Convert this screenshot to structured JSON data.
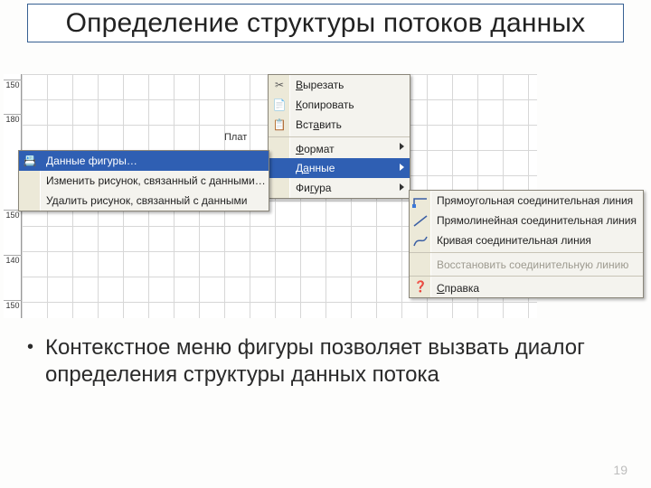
{
  "title": "Определение структуры потоков данных",
  "ruler_ticks": [
    "150",
    "180",
    "150",
    "140",
    "150"
  ],
  "shape_label": "Плат",
  "context_menu": {
    "cut": {
      "label": "Вырезать",
      "glyph": "✂"
    },
    "copy": {
      "label": "Копировать",
      "glyph": "📄"
    },
    "paste": {
      "label": "Вставить",
      "glyph": "📋"
    },
    "format": {
      "label": "Формат"
    },
    "data": {
      "label": "Данные"
    },
    "figure": {
      "label": "Фигура"
    }
  },
  "data_submenu": {
    "shape_data": {
      "label": "Данные фигуры…",
      "glyph": "📇"
    },
    "edit_picture": {
      "label": "Изменить рисунок, связанный с данными…"
    },
    "delete_picture": {
      "label": "Удалить рисунок, связанный с данными"
    }
  },
  "figure_submenu": {
    "rect_line": {
      "label": "Прямоугольная соединительная линия"
    },
    "straight": {
      "label": "Прямолинейная соединительная линия"
    },
    "curve": {
      "label": "Кривая соединительная линия"
    },
    "restore": {
      "label": "Восстановить соединительную линию"
    },
    "help": {
      "label": "Справка",
      "glyph": "❓"
    }
  },
  "bullet_text": "Контекстное меню фигуры позволяет вызвать диалог определения структуры данных потока",
  "page_number": "19"
}
